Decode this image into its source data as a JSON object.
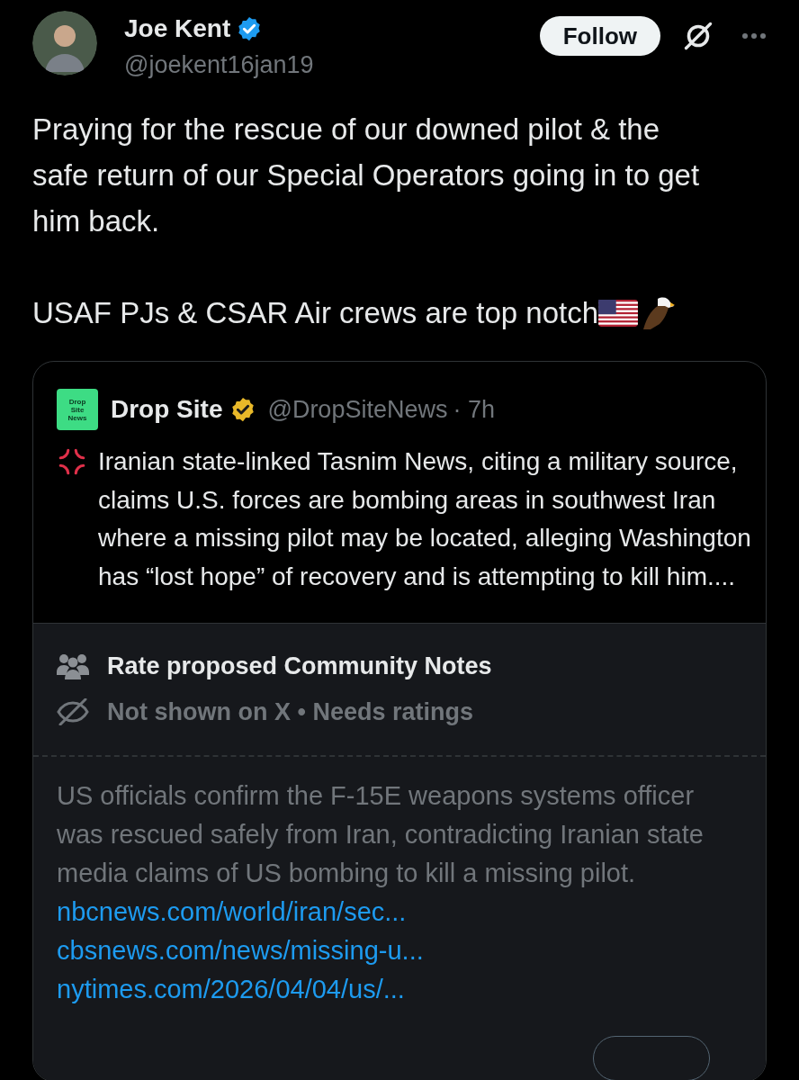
{
  "author": {
    "name": "Joe Kent",
    "handle": "@joekent16jan19",
    "verified": true
  },
  "follow_button": "Follow",
  "text": [
    "Praying for the rescue of our downed pilot & the safe return of our Special Operators going in to get him back.",
    "USAF PJs & CSAR Air crews are top notch"
  ],
  "quote": {
    "logo_text": "Drop Site News",
    "name": "Drop Site",
    "handle": "@DropSiteNews",
    "time": "· 7h",
    "text": "Iranian state-linked Tasnim News, citing a military source, claims U.S. forces are bombing areas in southwest Iran where a missing pilot may be located, alleging Washington has “lost hope” of recovery and is attempting to kill him...."
  },
  "community_note": {
    "title": "Rate proposed Community Notes",
    "status": "Not shown on X • Needs ratings",
    "text": "US officials confirm the F-15E weapons systems officer was rescued safely from Iran, contradicting Iranian state media claims of US bombing to kill a missing pilot.",
    "links": [
      "nbcnews.com/world/iran/sec...",
      "cbsnews.com/news/missing-u...",
      "nytimes.com/2026/04/04/us/..."
    ]
  }
}
